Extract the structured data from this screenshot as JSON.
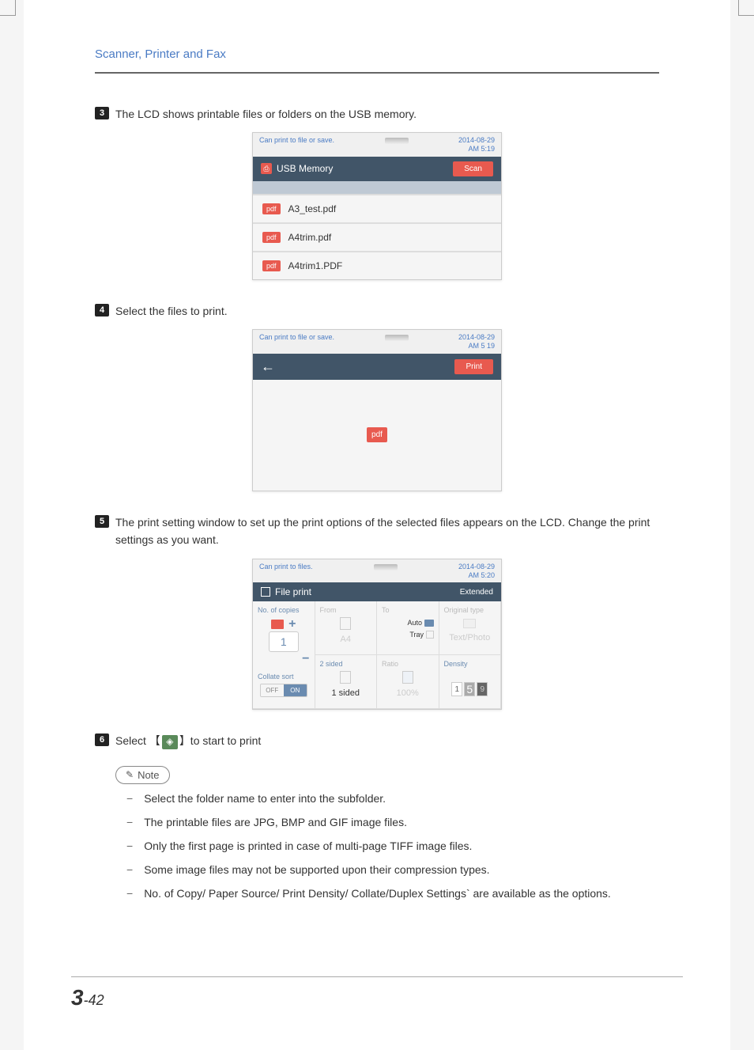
{
  "header": "Scanner, Printer and Fax",
  "steps": {
    "s3": {
      "num": "3",
      "text": "The LCD shows printable files or folders on the USB memory."
    },
    "s4": {
      "num": "4",
      "text": "Select the files to print."
    },
    "s5": {
      "num": "5",
      "text": "The print setting window to set up the print options of the selected files appears on the LCD. Change the print settings as you want."
    },
    "s5_cont": "print settings as you want.",
    "s6": {
      "num": "6",
      "text_before": "Select 【",
      "text_after": "】to start to print"
    }
  },
  "lcd1": {
    "status": "Can print to file or save.",
    "date": "2014-08-29",
    "time": "AM 5:19",
    "title": "USB Memory",
    "action": "Scan",
    "files": [
      "A3_test.pdf",
      "A4trim.pdf",
      "A4trim1.PDF"
    ],
    "pdf": "pdf"
  },
  "lcd2": {
    "status": "Can print to file or save.",
    "date": "2014-08-29",
    "time": "AM 5 19",
    "action": "Print",
    "pdf": "pdf"
  },
  "lcd3": {
    "status": "Can print to files.",
    "date": "2014-08-29",
    "time": "AM 5:20",
    "title": "File print",
    "extended": "Extended",
    "labels": {
      "copies": "No. of copies",
      "from": "From",
      "to": "To",
      "orig": "Original type",
      "sided_label": "2 sided",
      "ratio": "Ratio",
      "density": "Density",
      "collate": "Collate sort"
    },
    "values": {
      "copies": "1",
      "from": "A4",
      "auto": "Auto",
      "tray": "Tray",
      "orig_type": "Text/Photo",
      "sided": "1 sided",
      "ratio": "100%",
      "off": "OFF",
      "on": "ON",
      "d1": "1",
      "d5": "5",
      "d9": "9"
    }
  },
  "note": {
    "label": "Note",
    "items": [
      "Select the folder name to enter into the subfolder.",
      "The printable files are JPG, BMP and GIF image files.",
      "Only the first page is printed in case of multi-page TIFF image files.",
      "Some image files may not be supported upon their compression types.",
      "No. of Copy/ Paper Source/ Print Density/ Collate/Duplex Settings` are available as the options."
    ]
  },
  "footer": {
    "chapter": "3",
    "page": "-42"
  }
}
